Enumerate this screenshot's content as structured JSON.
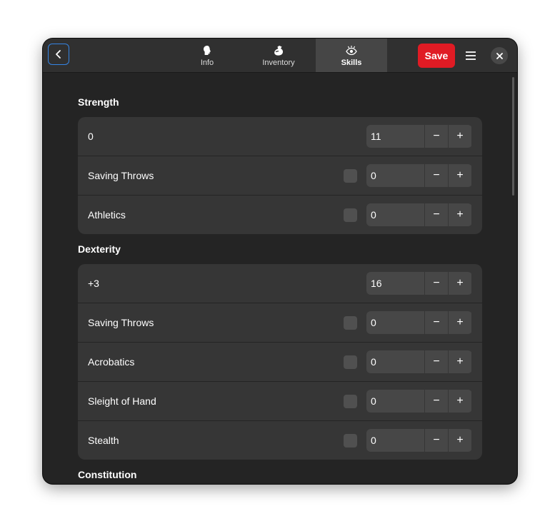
{
  "header": {
    "tabs": [
      {
        "label": "Info",
        "icon": "head-icon"
      },
      {
        "label": "Inventory",
        "icon": "bag-icon"
      },
      {
        "label": "Skills",
        "icon": "eye-icon"
      }
    ],
    "active_tab": "Skills",
    "save_label": "Save"
  },
  "colors": {
    "accent": "#3584e4",
    "save": "#e01b24",
    "window_bg": "#242424",
    "card_bg": "#363636"
  },
  "sections": [
    {
      "title": "Strength",
      "modifier": "0",
      "score": "11",
      "skills": [
        {
          "label": "Saving Throws",
          "value": "0"
        },
        {
          "label": "Athletics",
          "value": "0"
        }
      ]
    },
    {
      "title": "Dexterity",
      "modifier": "+3",
      "score": "16",
      "skills": [
        {
          "label": "Saving Throws",
          "value": "0"
        },
        {
          "label": "Acrobatics",
          "value": "0"
        },
        {
          "label": "Sleight of Hand",
          "value": "0"
        },
        {
          "label": "Stealth",
          "value": "0"
        }
      ]
    },
    {
      "title": "Constitution"
    }
  ]
}
